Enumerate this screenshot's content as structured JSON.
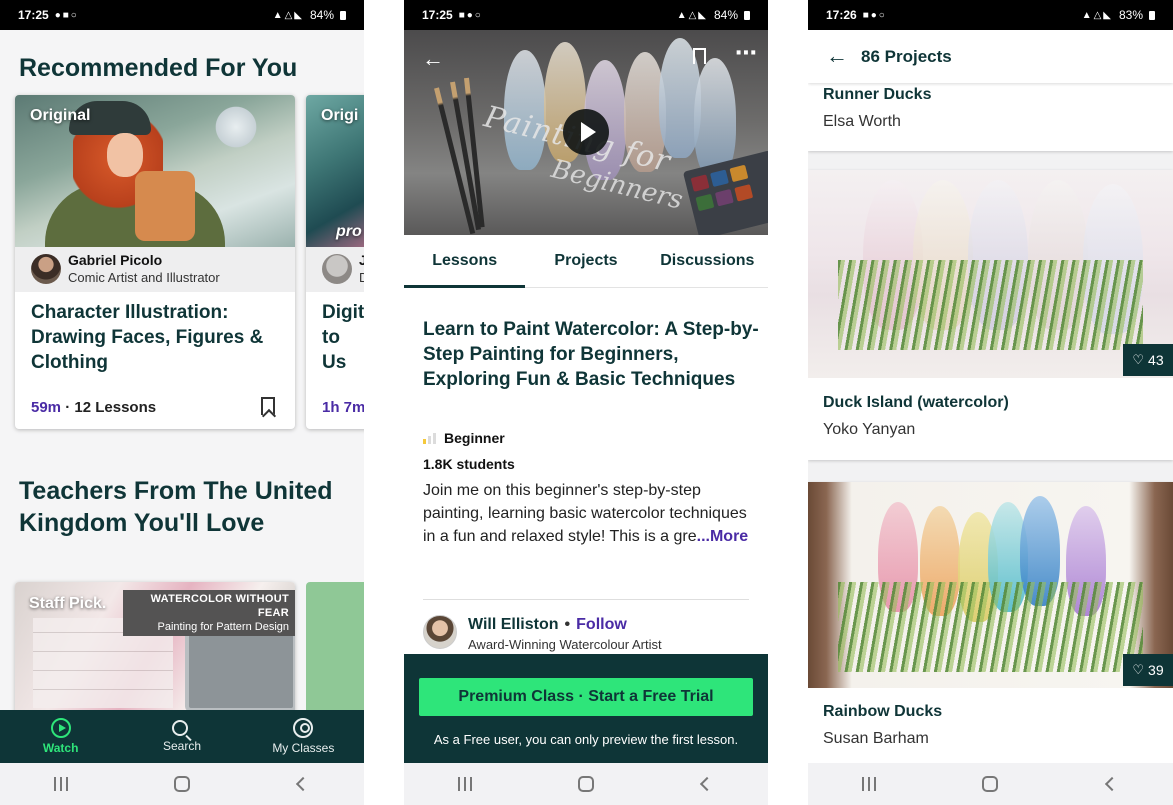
{
  "status_bars": [
    {
      "time": "17:25",
      "battery": "84%"
    },
    {
      "time": "17:25",
      "battery": "84%"
    },
    {
      "time": "17:26",
      "battery": "83%"
    }
  ],
  "phone1": {
    "recommended_title": "Recommended For You",
    "card1": {
      "badge": "Original",
      "teacher_name": "Gabriel Picolo",
      "teacher_title": "Comic Artist and Illustrator",
      "title": "Character Illustration: Drawing Faces, Figures & Clothing",
      "duration": "59m",
      "lessons": "12 Lessons"
    },
    "card2": {
      "badge": "Origi",
      "art_text": "pro",
      "teacher_name": "J",
      "teacher_title": "D",
      "title": "Digit to Us",
      "duration": "1h 7m"
    },
    "teachers_title": "Teachers From The United Kingdom You'll Love",
    "staff_card": {
      "badge": "Staff Pick.",
      "overlay_title": "WATERCOLOR WITHOUT FEAR",
      "overlay_sub": "Painting for Pattern Design"
    },
    "tabs": [
      {
        "label": "Watch",
        "icon": "play-circle-icon",
        "active": true
      },
      {
        "label": "Search",
        "icon": "search-icon",
        "active": false
      },
      {
        "label": "My Classes",
        "icon": "user-circle-icon",
        "active": false
      }
    ]
  },
  "phone2": {
    "video": {
      "title_line1": "Painting for",
      "title_line2": "Beginners"
    },
    "tabs": [
      "Lessons",
      "Projects",
      "Discussions"
    ],
    "class_title": "Learn to Paint Watercolor: A Step-by-Step Painting for Beginners, Exploring Fun & Basic Techniques",
    "level": "Beginner",
    "level_value": 1,
    "level_max": 3,
    "students": "1.8K students",
    "description": "Join me on this beginner's step-by-step painting, learning basic watercolor techniques in a fun and relaxed style! This is a gre",
    "more": "...More",
    "instructor_name": "Will Elliston",
    "separator": "•",
    "follow": "Follow",
    "instructor_title": "Award-Winning Watercolour Artist",
    "premium_button": "Premium Class · Start a Free Trial",
    "premium_note": "As a Free user, you can only preview the first lesson."
  },
  "phone3": {
    "header_title": "86 Projects",
    "projects": [
      {
        "title": "Runner Ducks",
        "author": "Elsa Worth"
      },
      {
        "title": "Duck Island (watercolor)",
        "author": "Yoko Yanyan",
        "likes": "43"
      },
      {
        "title": "Rainbow Ducks",
        "author": "Susan Barham",
        "likes": "39"
      }
    ]
  },
  "colors": {
    "brand_dark": "#0e3537",
    "accent_green": "#2ee57a",
    "accent_purple": "#4a2ba5"
  }
}
